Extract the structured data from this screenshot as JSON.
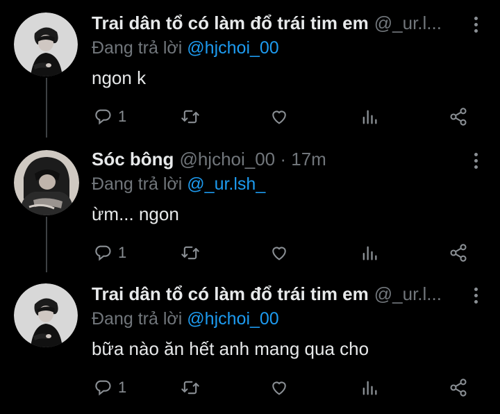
{
  "tweets": [
    {
      "name": "Trai dân tổ có làm đổ trái tim em",
      "handle": "@_ur.l...",
      "reply_prefix": "Đang trả lời",
      "reply_mention": "@hjchoi_00",
      "text": "ngon k",
      "reply_count": "1"
    },
    {
      "name": "Sóc bông",
      "handle": "@hjchoi_00 · 17m",
      "reply_prefix": "Đang trả lời",
      "reply_mention": "@_ur.lsh_",
      "text": "ừm... ngon",
      "reply_count": "1"
    },
    {
      "name": "Trai dân tổ có làm đổ trái tim em",
      "handle": "@_ur.l...",
      "reply_prefix": "Đang trả lời",
      "reply_mention": "@hjchoi_00",
      "text": "bữa nào ăn hết anh mang qua cho",
      "reply_count": "1"
    }
  ],
  "icons": {
    "reply": "reply-icon",
    "retweet": "retweet-icon",
    "like": "heart-icon",
    "views": "views-icon",
    "share": "share-icon",
    "more": "more-vertical-icon"
  },
  "colors": {
    "background": "#000000",
    "text": "#e7e9ea",
    "muted": "#71767b",
    "mention": "#1d9bf0"
  }
}
